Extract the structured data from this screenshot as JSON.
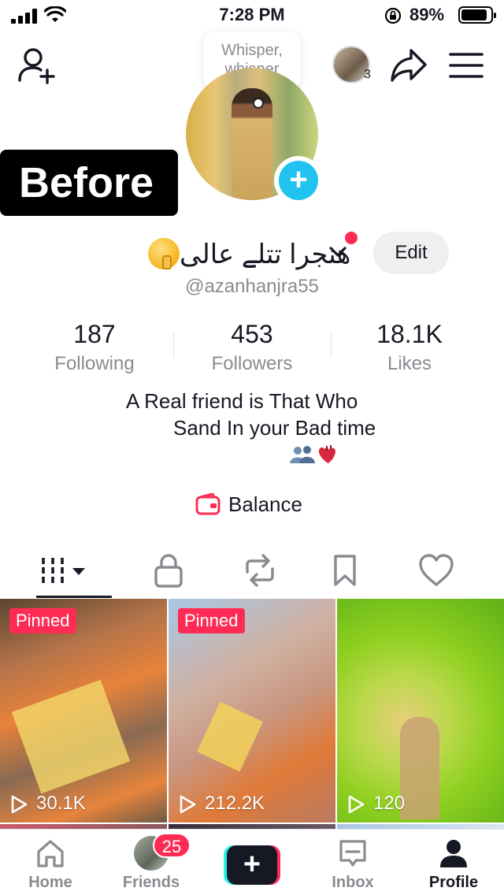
{
  "status_bar": {
    "time": "7:28 PM",
    "battery_percent_label": "89%",
    "battery_level": 0.89
  },
  "header": {
    "whisper_bubble": "Whisper, whisper",
    "story_avatar_count": "3",
    "before_label": "Before"
  },
  "profile": {
    "display_name": "هنجرا تتلے عالی",
    "handle": "@azanhanjra55",
    "edit_label": "Edit"
  },
  "stats": [
    {
      "value": "187",
      "label": "Following"
    },
    {
      "value": "453",
      "label": "Followers"
    },
    {
      "value": "18.1K",
      "label": "Likes"
    }
  ],
  "bio": {
    "line1": "A Real friend is That Who",
    "line2": "Sand In your Bad time"
  },
  "balance": {
    "label": "Balance"
  },
  "tabs": [
    {
      "icon": "grid-icon",
      "active": true
    },
    {
      "icon": "lock-icon"
    },
    {
      "icon": "repost-icon"
    },
    {
      "icon": "bookmark-icon"
    },
    {
      "icon": "heart-icon"
    }
  ],
  "videos": [
    {
      "pinned": "Pinned",
      "views": "30.1K"
    },
    {
      "pinned": "Pinned",
      "views": "212.2K"
    },
    {
      "pinned": "",
      "views": "120"
    }
  ],
  "bottom_nav": {
    "home": "Home",
    "friends": "Friends",
    "friends_badge": "25",
    "inbox": "Inbox",
    "profile": "Profile"
  },
  "colors": {
    "accent": "#fe2c55",
    "cyan": "#20c3f0",
    "text": "#161823",
    "muted": "#8a8b91"
  }
}
